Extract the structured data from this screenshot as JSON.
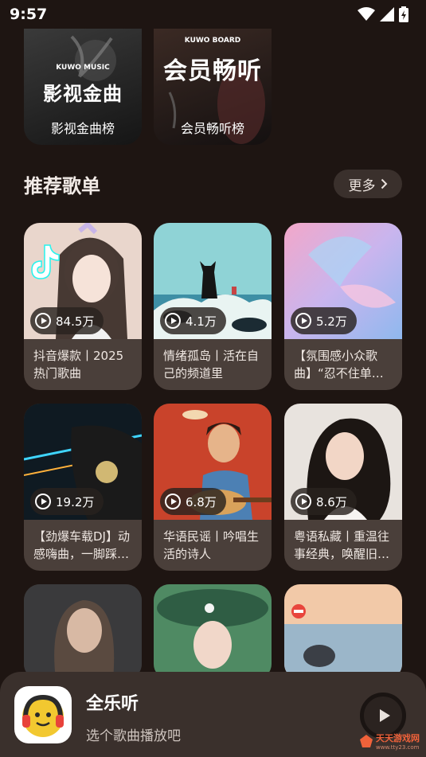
{
  "status_bar": {
    "time": "9:57"
  },
  "top_charts": [
    {
      "brand": "KUWO MUSIC",
      "title": "影视金曲",
      "caption": "影视金曲榜"
    },
    {
      "brand": "KUWO BOARD",
      "title": "会员畅听",
      "caption": "会员畅听榜"
    }
  ],
  "section": {
    "title": "推荐歌单",
    "more_label": "更多"
  },
  "playlists": [
    {
      "plays": "84.5万",
      "title": "抖音爆款丨2025热门歌曲"
    },
    {
      "plays": "4.1万",
      "title": "情绪孤岛丨活在自己的频道里"
    },
    {
      "plays": "5.2万",
      "title": "【氛围感小众歌曲】“忍不住单曲循环”"
    },
    {
      "plays": "19.2万",
      "title": "【劲爆车载DJ】动感嗨曲，一脚踩油门"
    },
    {
      "plays": "6.8万",
      "title": "华语民谣丨吟唱生活的诗人"
    },
    {
      "plays": "8.6万",
      "title": "粤语私藏丨重温往事经典，唤醒旧时光"
    }
  ],
  "player": {
    "name": "全乐听",
    "subtitle": "选个歌曲播放吧"
  },
  "watermark": {
    "text": "天天游戏网",
    "url": "www.tty23.com"
  },
  "colors": {
    "background": "#1e1512",
    "card": "#4a3f3a",
    "player": "#3a302c"
  }
}
